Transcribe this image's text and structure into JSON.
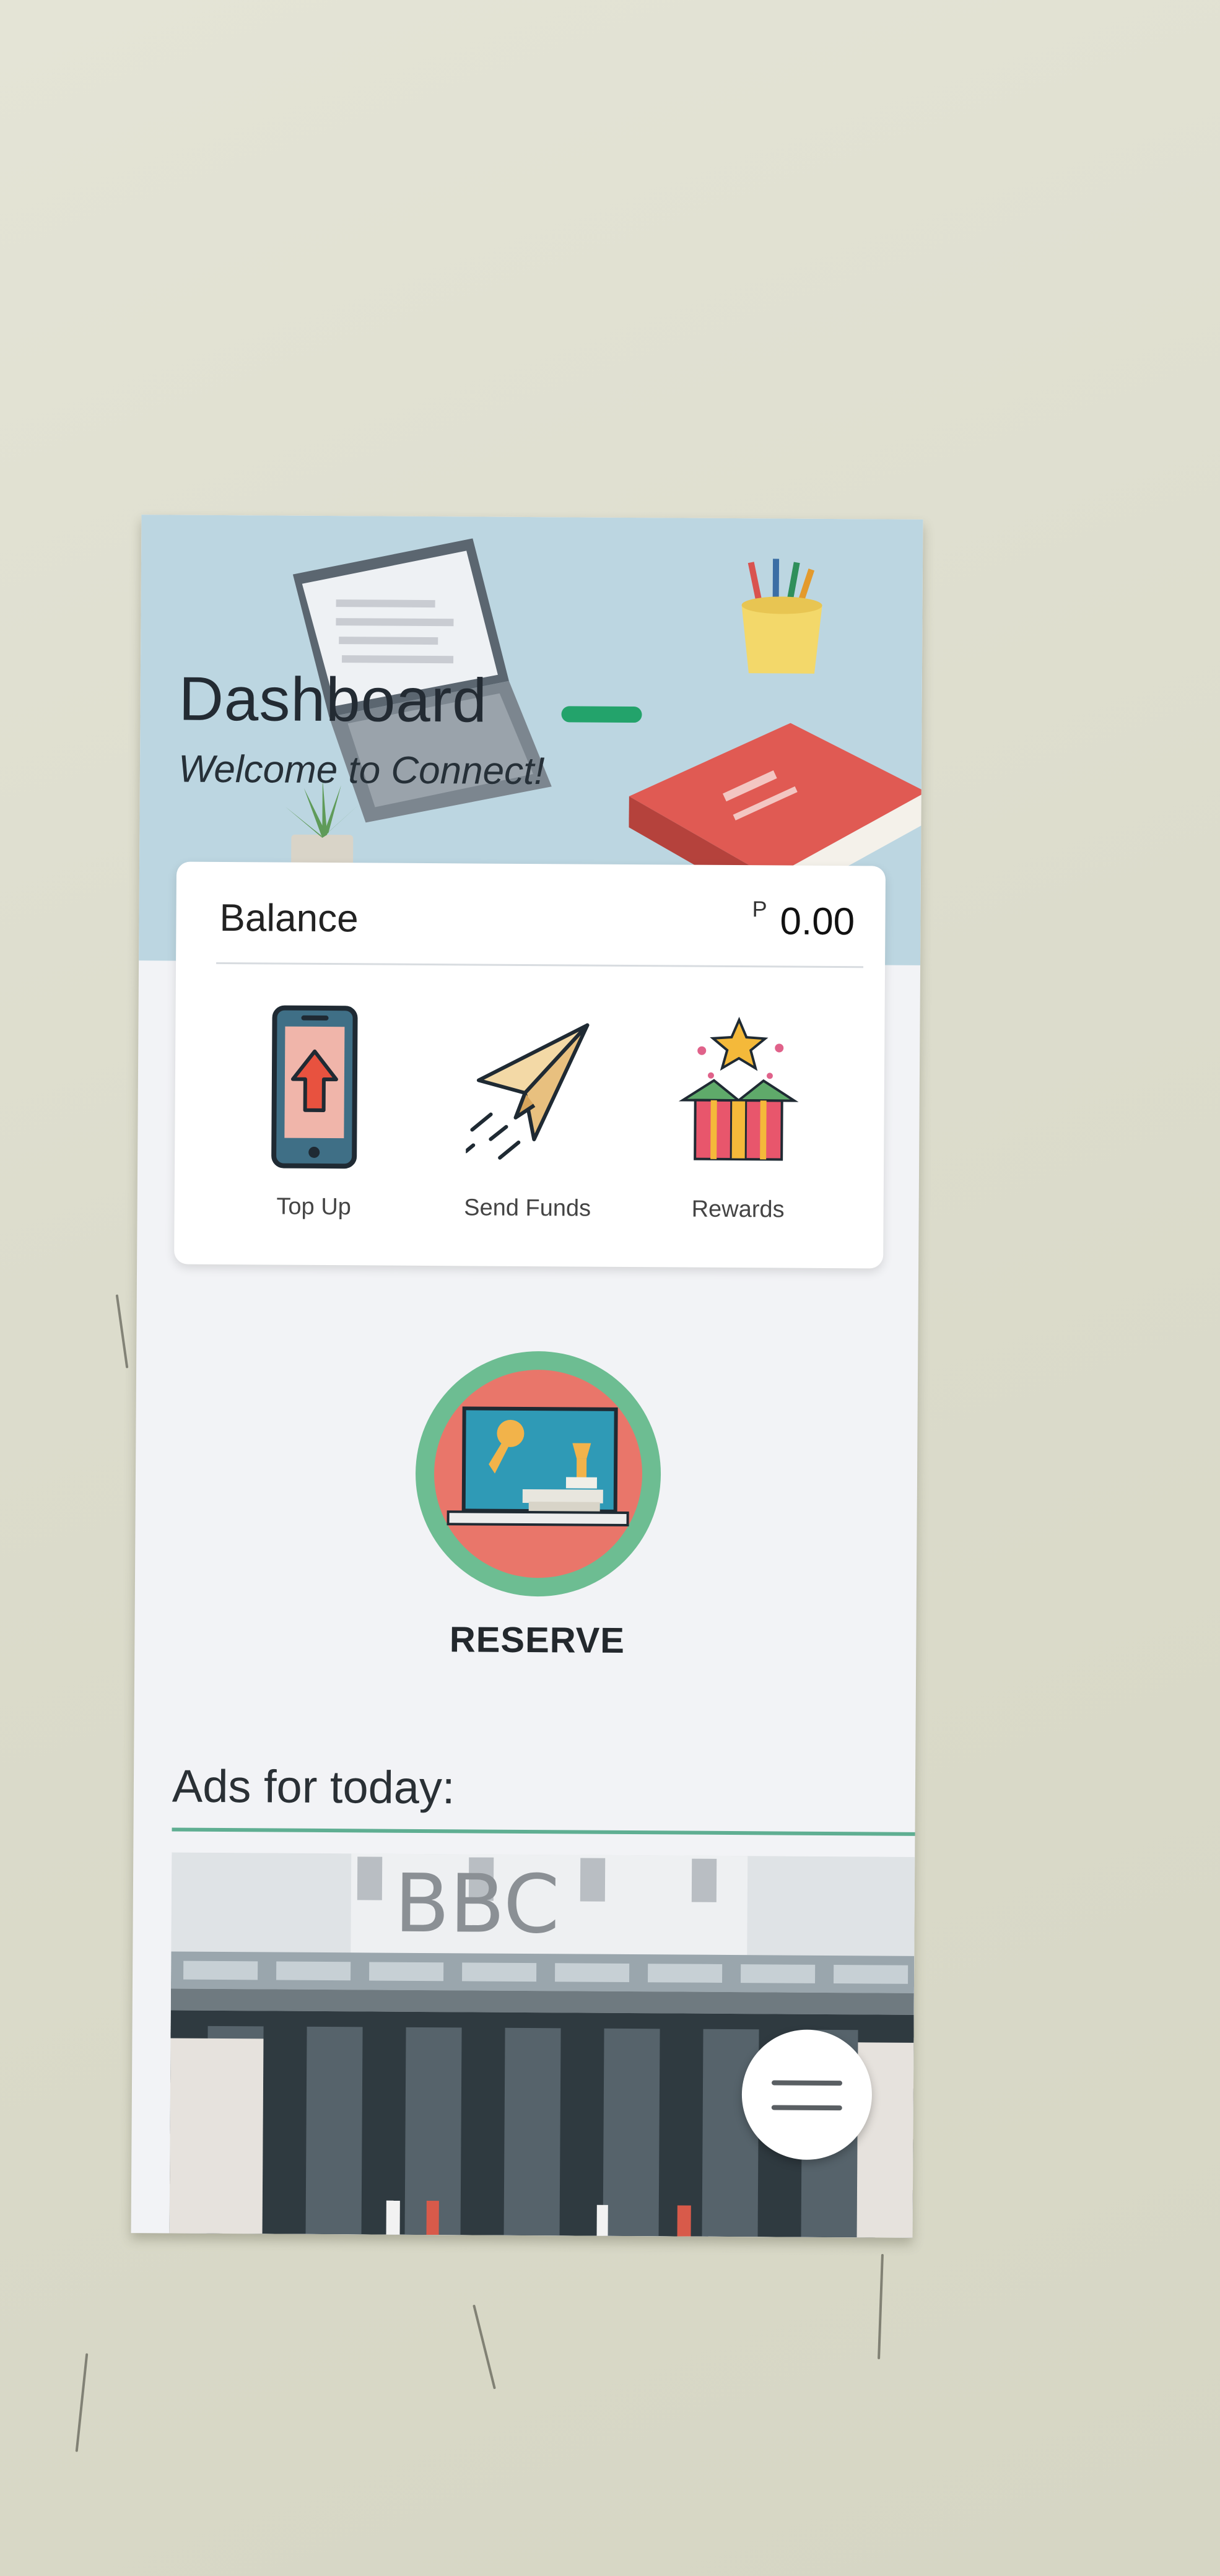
{
  "header": {
    "title": "Dashboard",
    "subtitle": "Welcome to Connect!"
  },
  "balance": {
    "label": "Balance",
    "currency_symbol": "P",
    "amount": "0.00"
  },
  "actions": [
    {
      "label": "Top Up",
      "icon": "phone-upload-icon"
    },
    {
      "label": "Send Funds",
      "icon": "paper-plane-icon"
    },
    {
      "label": "Rewards",
      "icon": "gift-box-icon"
    }
  ],
  "reserve": {
    "label": "RESERVE",
    "icon": "reserve-desk-icon"
  },
  "ads": {
    "title": "Ads for today:",
    "banner_text": "BBC"
  },
  "menu_button": {
    "icon": "hamburger-menu-icon"
  },
  "colors": {
    "accent_green": "#23a36b",
    "header_bg": "#bcd6e1",
    "divider_green": "#5fae92"
  }
}
